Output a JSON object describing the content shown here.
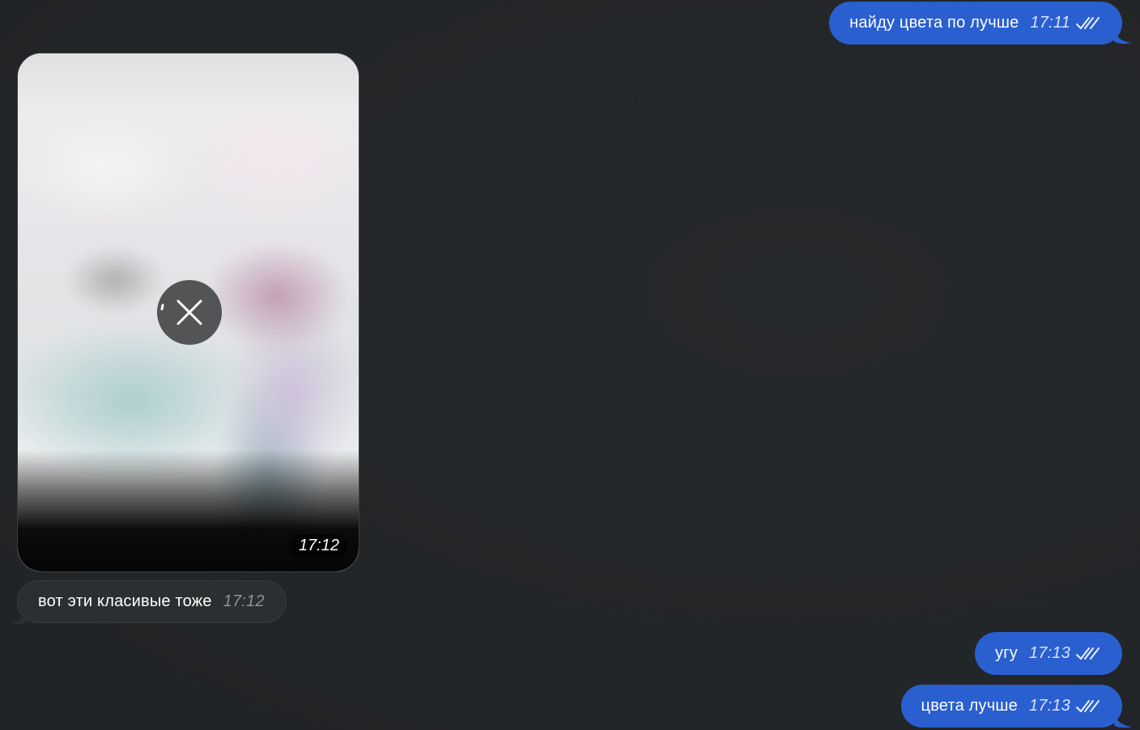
{
  "colors": {
    "background": "#232628",
    "outgoing_bubble": "#2a5fd0",
    "incoming_bubble": "#2c2f31"
  },
  "messages": [
    {
      "direction": "outgoing",
      "text": "найду цвета по лучше",
      "time": "17:11",
      "status_icon": "double-check-icon"
    },
    {
      "direction": "incoming",
      "type": "media",
      "media_icon": "close-icon",
      "time": "17:12"
    },
    {
      "direction": "incoming",
      "text": "вот эти класивые тоже",
      "time": "17:12"
    },
    {
      "direction": "outgoing",
      "text": "угу",
      "time": "17:13",
      "status_icon": "double-check-icon"
    },
    {
      "direction": "outgoing",
      "text": "цвета лучше",
      "time": "17:13",
      "status_icon": "double-check-icon"
    }
  ]
}
